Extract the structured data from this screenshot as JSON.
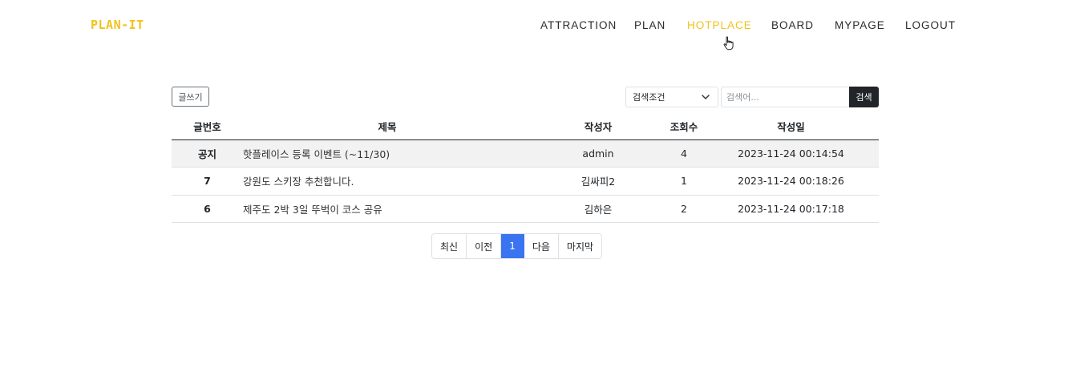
{
  "header": {
    "logo": "PLAN-IT",
    "nav": [
      {
        "label": "ATTRACTION",
        "active": false
      },
      {
        "label": "PLAN",
        "active": false
      },
      {
        "label": "HOTPLACE",
        "active": true
      },
      {
        "label": "BOARD",
        "active": false
      },
      {
        "label": "MYPAGE",
        "active": false
      },
      {
        "label": "LOGOUT",
        "active": false
      }
    ],
    "accent_color": "#f2c21b"
  },
  "toolbar": {
    "write_label": "글쓰기",
    "search_condition_selected": "검색조건",
    "search_placeholder": "검색어...",
    "search_button_label": "검색"
  },
  "table": {
    "headers": [
      "글번호",
      "제목",
      "작성자",
      "조회수",
      "작성일"
    ],
    "rows": [
      {
        "no": "공지",
        "title": "핫플레이스 등록 이벤트 (~11/30)",
        "author": "admin",
        "views": "4",
        "date": "2023-11-24 00:14:54",
        "notice": true
      },
      {
        "no": "7",
        "title": "강원도 스키장 추천합니다.",
        "author": "김싸피2",
        "views": "1",
        "date": "2023-11-24 00:18:26",
        "notice": false
      },
      {
        "no": "6",
        "title": "제주도 2박 3일 뚜벅이 코스 공유",
        "author": "김하은",
        "views": "2",
        "date": "2023-11-24 00:17:18",
        "notice": false
      }
    ]
  },
  "pagination": {
    "first": "최신",
    "prev": "이전",
    "current": "1",
    "next": "다음",
    "last": "마지막",
    "active_color": "#3b74f0"
  },
  "icons": {
    "dropdown": "chevron-down-icon",
    "cursor": "hand-pointer-icon"
  }
}
